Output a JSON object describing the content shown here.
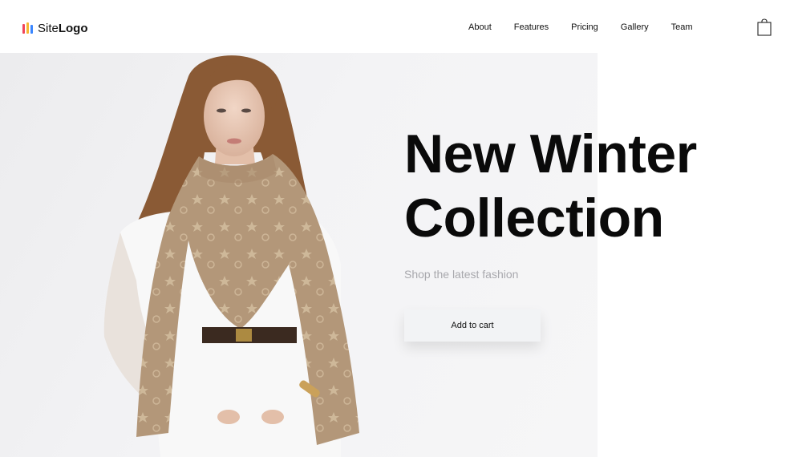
{
  "brand": {
    "site": "Site",
    "logo": "Logo",
    "mark_colors": [
      "#f0455a",
      "#f7b731",
      "#3a86ff"
    ]
  },
  "nav": {
    "items": [
      {
        "label": "About"
      },
      {
        "label": "Features"
      },
      {
        "label": "Pricing"
      },
      {
        "label": "Gallery"
      },
      {
        "label": "Team"
      }
    ]
  },
  "cart": {
    "icon": "shopping-bag-icon"
  },
  "hero": {
    "title_line1": "New Winter",
    "title_line2": "Collection",
    "subtitle": "Shop the latest fashion",
    "cta_label": "Add to cart",
    "image": "model-with-scarf-photo"
  },
  "colors": {
    "scarf": "#b39779",
    "belt": "#3b2a20",
    "hair": "#8a5a35",
    "outfit": "#f8f8f8"
  }
}
